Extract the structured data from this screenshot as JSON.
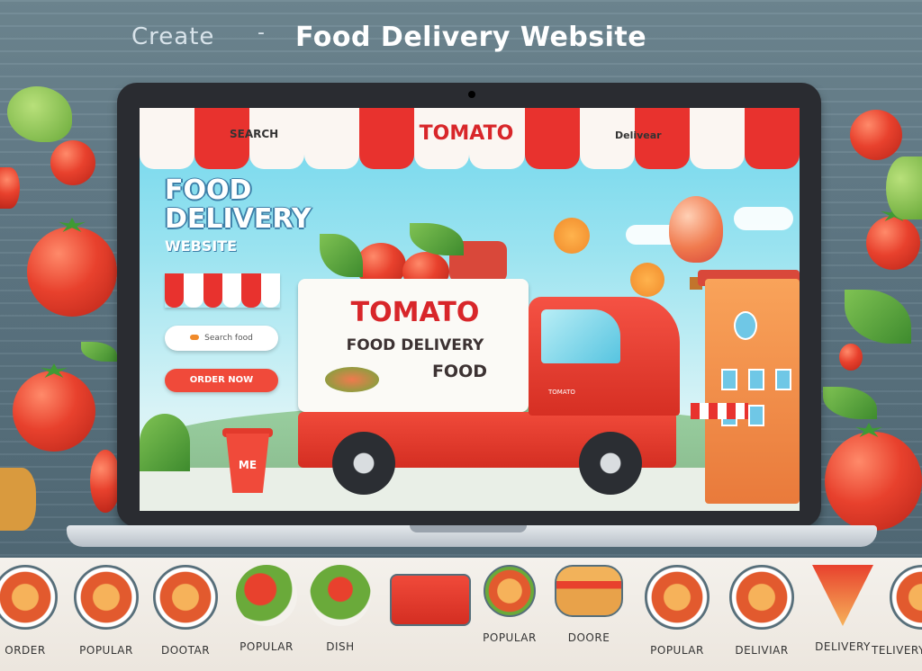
{
  "header": {
    "prefix": "Create",
    "dash": "-",
    "title": "Food Delivery Website"
  },
  "nav": {
    "search_label": "SEARCH",
    "brand": "TOMATO",
    "delivery_label": "Delivear"
  },
  "hero": {
    "title_line1": "FOOD",
    "title_line2": "DELIVERY",
    "subtitle": "WEBSITE",
    "search_text": "Search food",
    "cta_label": "ORDER NOW"
  },
  "truck": {
    "brand": "TOMATO",
    "line1": "FOOD DELIVERY",
    "line2": "FOOD",
    "door_text": "TOMATO",
    "cup_text": "ME"
  },
  "categories": [
    {
      "label": "ORDER",
      "icon": "food-bowl-icon"
    },
    {
      "label": "POPULAR",
      "icon": "food-bowl-icon"
    },
    {
      "label": "DOOTAR",
      "icon": "food-bowl-icon"
    },
    {
      "label": "POPULAR",
      "icon": "veggies-icon"
    },
    {
      "label": "DISH",
      "icon": "salad-icon"
    },
    {
      "label": "",
      "icon": "truck-icon"
    },
    {
      "label": "POPULAR",
      "icon": "burger-icon"
    },
    {
      "label": "DOORE",
      "icon": "dish-icon"
    },
    {
      "label": "POPULAR",
      "icon": "sandwich-icon"
    },
    {
      "label": "DELIVIAR",
      "icon": "pizza-icon"
    },
    {
      "label": "DELIVERY",
      "icon": "noodle-icon"
    },
    {
      "label": "TELIVERY",
      "icon": "pizza-slice-icon"
    }
  ],
  "colors": {
    "brand_red": "#d8262a",
    "awning_red": "#e8322e",
    "sky": "#6fd6ec",
    "background": "#566f7b"
  }
}
